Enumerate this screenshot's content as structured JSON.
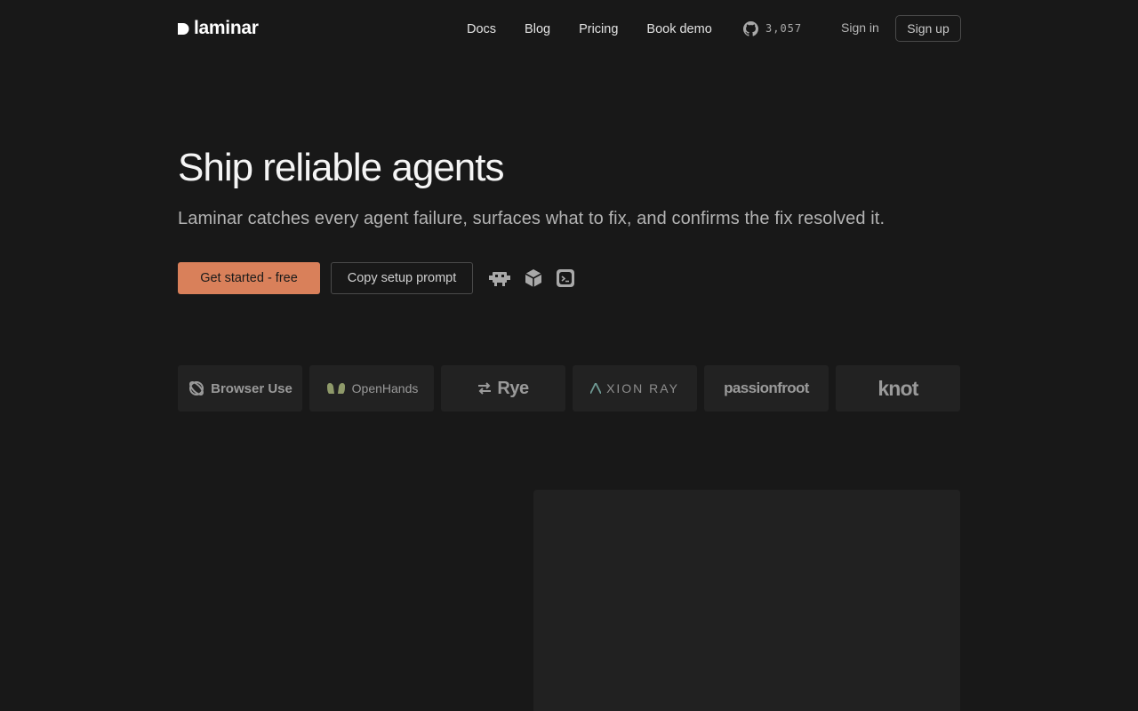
{
  "nav": {
    "brand": "laminar",
    "links": [
      "Docs",
      "Blog",
      "Pricing",
      "Book demo"
    ],
    "github_stars": "3,057",
    "signin": "Sign in",
    "signup": "Sign up"
  },
  "hero": {
    "title": "Ship reliable agents",
    "subtitle": "Laminar catches every agent failure, surfaces what to fix, and confirms the fix resolved it.",
    "primary_cta": "Get started - free",
    "secondary_cta": "Copy setup prompt",
    "tool_icons": [
      "robot-icon",
      "cube-icon",
      "terminal-icon"
    ]
  },
  "customers": {
    "logos": [
      "Browser Use",
      "OpenHands",
      "Rye",
      "XION RAY",
      "passionfroot",
      "knot"
    ]
  },
  "colors": {
    "background": "#181818",
    "accent": "#d9805a",
    "card": "#222222"
  }
}
